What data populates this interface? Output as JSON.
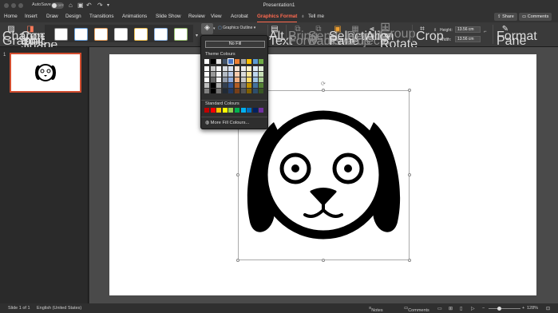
{
  "titlebar": {
    "autosave_label": "AutoSave",
    "autosave_state": "OFF",
    "title": "Presentation1"
  },
  "tabs": [
    "Home",
    "Insert",
    "Draw",
    "Design",
    "Transitions",
    "Animations",
    "Slide Show",
    "Review",
    "View",
    "Acrobat",
    "Graphics Format",
    "Tell me"
  ],
  "active_tab": "Graphics Format",
  "share": {
    "share_label": "Share",
    "comments_label": "Comments"
  },
  "ribbon": {
    "change_graphic": "Change Graphic",
    "convert_to_shape": "Convert to Shape",
    "graphics_outline": "Graphics Outline",
    "alt_text": "Alt Text",
    "bring_forwards": "Bring Forwards",
    "send_backwards": "Send Backwards",
    "selection_pane": "Selection Pane",
    "reorder_objects": "Reorder Objects",
    "align": "Align",
    "group": "Group",
    "rotate": "Rotate",
    "crop": "Crop",
    "height_label": "Height:",
    "height_value": "13.56 cm",
    "width_label": "Width:",
    "width_value": "13.56 cm",
    "format_pane": "Format Pane"
  },
  "fill_menu": {
    "no_fill": "No Fill",
    "theme_colours": "Theme Colours",
    "standard_colours": "Standard Colours",
    "more_fill": "More Fill Colours...",
    "theme_top": [
      "#ffffff",
      "#000000",
      "#e7e6e6",
      "#44546a",
      "#4472c4",
      "#ed7d31",
      "#a5a5a5",
      "#ffc000",
      "#5b9bd5",
      "#70ad47"
    ],
    "standard": [
      "#c00000",
      "#ff0000",
      "#ffc000",
      "#ffff00",
      "#92d050",
      "#00b050",
      "#00b0f0",
      "#0070c0",
      "#002060",
      "#7030a0"
    ]
  },
  "slide_panel": {
    "slide_number": "1"
  },
  "status": {
    "slide_info": "Slide 1 of 1",
    "language": "English (United States)",
    "notes": "Notes",
    "comments": "Comments",
    "zoom": "128%"
  }
}
